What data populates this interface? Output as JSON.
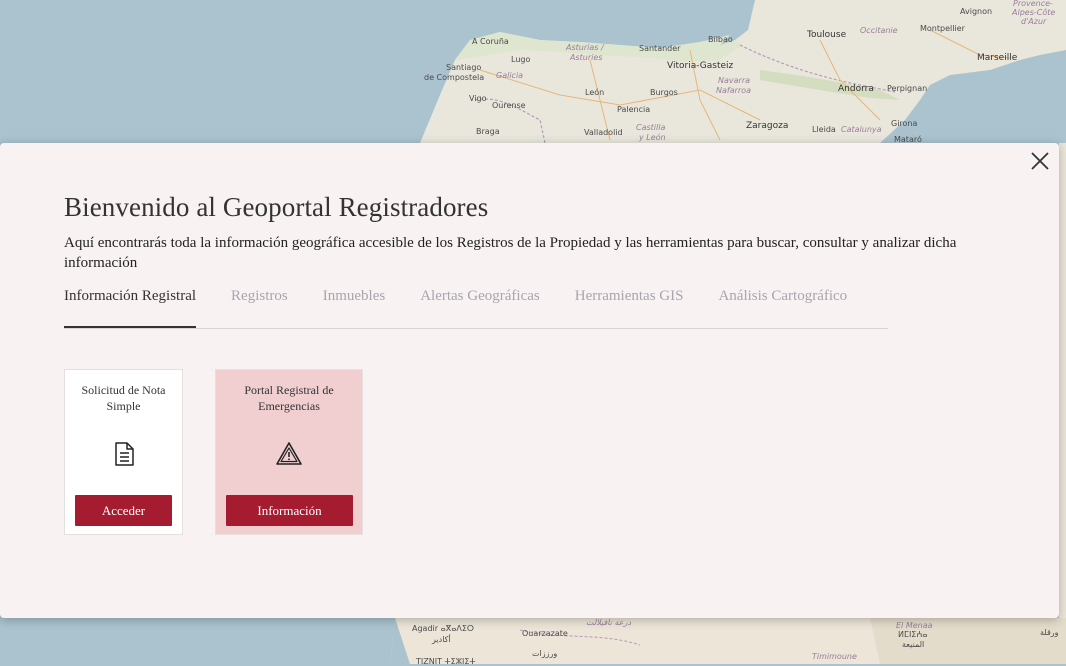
{
  "map": {
    "labels": {
      "a_coruna": "A Coruña",
      "lugo": "Lugo",
      "asturias": "Asturias /",
      "asturies": "Asturies",
      "santander": "Santander",
      "bilbao": "Bilbao",
      "santiago": "Santiago",
      "de_compostela": "de Compostela",
      "galicia": "Galicia",
      "vitoria": "Vitoria-Gasteiz",
      "leon": "León",
      "burgos": "Burgos",
      "navarra": "Navarra",
      "nafarroa": "Nafarroa",
      "andorra": "Andorra",
      "perpignan": "Perpignan",
      "vigo": "Vigo",
      "ourense": "Ourense",
      "palencia": "Palencia",
      "braga": "Braga",
      "valladolid": "Valladolid",
      "castilla": "Castilla",
      "y_leon": "y León",
      "zaragoza": "Zaragoza",
      "lleida": "Lleida",
      "catalunya": "Catalunya",
      "girona": "Girona",
      "mataro": "Mataró",
      "toulouse": "Toulouse",
      "occitanie": "Occitanie",
      "montpellier": "Montpellier",
      "marseille": "Marseille",
      "avignon": "Avignon",
      "provence": "Provence-",
      "alpes": "Alpes-Côte",
      "dazur": "d'Azur",
      "agadir": "Agadir ⴰⴳⴰⴷⵉⵔ",
      "agadir_ar": "أكادير",
      "ouarzazate": "Ouarzazate",
      "ouarzazate_ar": "ورززات",
      "draa": "درعة تافيلالت",
      "el_menaa": "El Menaa",
      "el_menaa_tif": "ⵍⵎⵏⵉⵄⴰ",
      "el_menaa_ar": "المنيعة",
      "timimoune": "Timimoune",
      "ouargla": "ورقلة",
      "tiznit": "TIZNIT ⵜⵉⵣⵏⵉⵜ"
    }
  },
  "modal": {
    "title": "Bienvenido al Geoportal Registradores",
    "subtitle": "Aquí encontrarás toda la información geográfica accesible de los Registros de la Propiedad y las herramientas para buscar, consultar y analizar dicha información",
    "close_icon": "close-icon",
    "tabs": [
      {
        "label": "Información Registral",
        "active": true
      },
      {
        "label": "Registros",
        "active": false
      },
      {
        "label": "Inmuebles",
        "active": false
      },
      {
        "label": "Alertas Geográficas",
        "active": false
      },
      {
        "label": "Herramientas GIS",
        "active": false
      },
      {
        "label": "Análisis Cartográfico",
        "active": false
      }
    ],
    "cards": [
      {
        "title": "Solicitud de Nota Simple",
        "icon": "document-icon",
        "button": "Acceder"
      },
      {
        "title": "Portal Registral de Emergencias",
        "icon": "warning-icon",
        "button": "Información"
      }
    ]
  },
  "colors": {
    "accent": "#a51c30",
    "highlight_card": "#f1cfd1",
    "modal_bg": "#f8f2f3",
    "sea": "#aac3cf"
  }
}
